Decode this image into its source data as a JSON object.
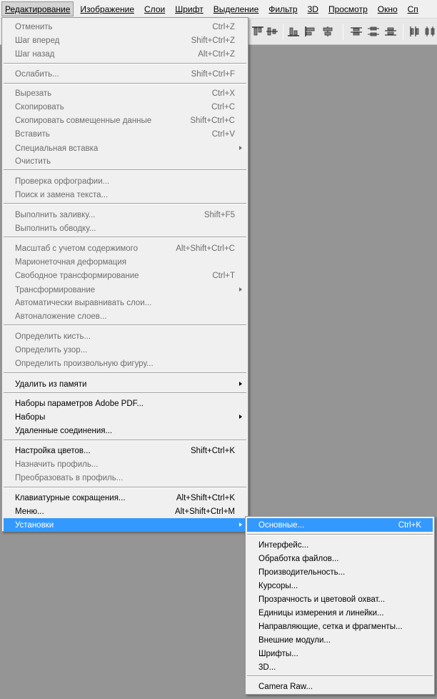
{
  "menubar": {
    "items": [
      "Редактирование",
      "Изображение",
      "Слои",
      "Шрифт",
      "Выделение",
      "Фильтр",
      "3D",
      "Просмотр",
      "Окно",
      "Сп"
    ]
  },
  "toolbar": {
    "icons": [
      "align-top-edges-icon",
      "align-vertical-centers-icon",
      "align-bottom-edges-icon",
      "align-left-edges-icon",
      "align-horizontal-centers-icon",
      "align-right-edges-icon",
      "distribute-top-icon",
      "distribute-vertical-centers-icon",
      "distribute-bottom-icon",
      "distribute-left-icon",
      "distribute-horizontal-centers-icon"
    ]
  },
  "edit_menu": {
    "items": {
      "undo": {
        "label": "Отменить",
        "shortcut": "Ctrl+Z"
      },
      "step_forward": {
        "label": "Шаг вперед",
        "shortcut": "Shift+Ctrl+Z"
      },
      "step_back": {
        "label": "Шаг назад",
        "shortcut": "Alt+Ctrl+Z"
      },
      "fade": {
        "label": "Ослабить...",
        "shortcut": "Shift+Ctrl+F"
      },
      "cut": {
        "label": "Вырезать",
        "shortcut": "Ctrl+X"
      },
      "copy": {
        "label": "Скопировать",
        "shortcut": "Ctrl+C"
      },
      "copy_merged": {
        "label": "Скопировать совмещенные данные",
        "shortcut": "Shift+Ctrl+C"
      },
      "paste": {
        "label": "Вставить",
        "shortcut": "Ctrl+V"
      },
      "paste_special": {
        "label": "Специальная вставка"
      },
      "clear": {
        "label": "Очистить"
      },
      "check_spelling": {
        "label": "Проверка орфографии..."
      },
      "find_replace": {
        "label": "Поиск и замена текста..."
      },
      "fill": {
        "label": "Выполнить заливку...",
        "shortcut": "Shift+F5"
      },
      "stroke": {
        "label": "Выполнить обводку..."
      },
      "content_aware_scale": {
        "label": "Масштаб с учетом содержимого",
        "shortcut": "Alt+Shift+Ctrl+C"
      },
      "puppet_warp": {
        "label": "Марионеточная деформация"
      },
      "free_transform": {
        "label": "Свободное трансформирование",
        "shortcut": "Ctrl+T"
      },
      "transform": {
        "label": "Трансформирование"
      },
      "auto_align": {
        "label": "Автоматически выравнивать слои..."
      },
      "auto_blend": {
        "label": "Автоналожение слоев..."
      },
      "define_brush": {
        "label": "Определить кисть..."
      },
      "define_pattern": {
        "label": "Определить узор..."
      },
      "define_shape": {
        "label": "Определить произвольную фигуру..."
      },
      "purge": {
        "label": "Удалить из памяти"
      },
      "pdf_presets": {
        "label": "Наборы параметров Adobe PDF..."
      },
      "presets": {
        "label": "Наборы"
      },
      "remote_connections": {
        "label": "Удаленные соединения..."
      },
      "color_settings": {
        "label": "Настройка цветов...",
        "shortcut": "Shift+Ctrl+K"
      },
      "assign_profile": {
        "label": "Назначить профиль..."
      },
      "convert_profile": {
        "label": "Преобразовать в профиль..."
      },
      "keyboard_shortcuts": {
        "label": "Клавиатурные сокращения...",
        "shortcut": "Alt+Shift+Ctrl+K"
      },
      "menus": {
        "label": "Меню...",
        "shortcut": "Alt+Shift+Ctrl+M"
      },
      "preferences": {
        "label": "Установки"
      }
    }
  },
  "prefs_submenu": {
    "items": {
      "general": {
        "label": "Основные...",
        "shortcut": "Ctrl+K"
      },
      "interface": {
        "label": "Интерфейс..."
      },
      "file_handling": {
        "label": "Обработка файлов..."
      },
      "performance": {
        "label": "Производительность..."
      },
      "cursors": {
        "label": "Курсоры..."
      },
      "transparency": {
        "label": "Прозрачность и цветовой охват..."
      },
      "units": {
        "label": "Единицы измерения и линейки..."
      },
      "guides": {
        "label": "Направляющие, сетка и фрагменты..."
      },
      "plugins": {
        "label": "Внешние модули..."
      },
      "type": {
        "label": "Шрифты..."
      },
      "3d": {
        "label": "3D..."
      },
      "camera_raw": {
        "label": "Camera Raw..."
      }
    }
  },
  "colors": {
    "highlight": "#3399ff",
    "menu_bg": "#f0f0f0",
    "canvas_bg": "#959595",
    "disabled_text": "#6d6d6d"
  }
}
